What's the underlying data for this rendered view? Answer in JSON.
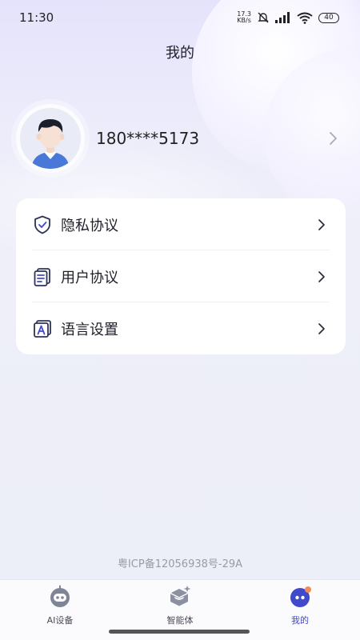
{
  "status_bar": {
    "time": "11:30",
    "net_speed_value": "17.3",
    "net_speed_unit": "KB/s",
    "battery": "40"
  },
  "header": {
    "title": "我的"
  },
  "profile": {
    "phone": "180****5173"
  },
  "menu": {
    "items": [
      {
        "label": "隐私协议",
        "icon": "shield-check-icon"
      },
      {
        "label": "用户协议",
        "icon": "document-icon"
      },
      {
        "label": "语言设置",
        "icon": "language-icon"
      }
    ]
  },
  "footer": {
    "icp": "粤ICP备12056938号-29A"
  },
  "tabbar": {
    "tabs": [
      {
        "label": "AI设备",
        "icon": "robot-icon",
        "active": false
      },
      {
        "label": "智能体",
        "icon": "agent-box-icon",
        "active": false
      },
      {
        "label": "我的",
        "icon": "profile-face-icon",
        "active": true
      }
    ]
  },
  "colors": {
    "accent": "#3f49c9",
    "icon_dark": "#2e3358",
    "text_primary": "#1f1f2a",
    "text_muted": "#9a9aa6"
  }
}
